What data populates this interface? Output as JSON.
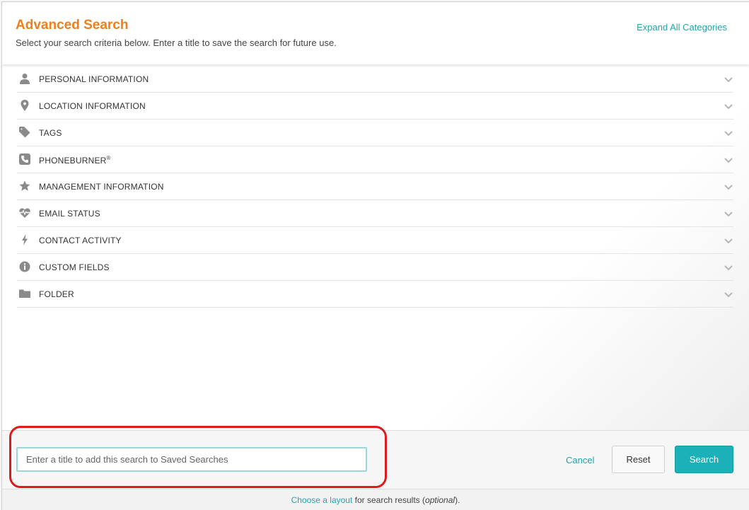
{
  "header": {
    "title": "Advanced Search",
    "subtitle": "Select your search criteria below. Enter a title to save the search for future use.",
    "expand_all": "Expand All Categories"
  },
  "categories": [
    {
      "label": "PERSONAL INFORMATION",
      "icon": "user-icon"
    },
    {
      "label": "LOCATION INFORMATION",
      "icon": "map-pin-icon"
    },
    {
      "label": "TAGS",
      "icon": "tag-icon"
    },
    {
      "label": "PHONEBURNER",
      "sup": "®",
      "icon": "phone-icon"
    },
    {
      "label": "MANAGEMENT INFORMATION",
      "icon": "star-icon"
    },
    {
      "label": "EMAIL STATUS",
      "icon": "heartbeat-icon"
    },
    {
      "label": "CONTACT ACTIVITY",
      "icon": "bolt-icon"
    },
    {
      "label": "CUSTOM FIELDS",
      "icon": "info-circle-icon"
    },
    {
      "label": "FOLDER",
      "icon": "folder-icon"
    }
  ],
  "footer": {
    "title_placeholder": "Enter a title to add this search to Saved Searches",
    "title_value": "",
    "cancel": "Cancel",
    "reset": "Reset",
    "search": "Search"
  },
  "layout_bar": {
    "prefix": "",
    "link": "Choose a layout",
    "middle": " for search results (",
    "optional": "optional",
    "suffix": ")."
  },
  "colors": {
    "accent_orange": "#ef7f1a",
    "link_teal": "#26a3a8",
    "button_teal": "#1cb1b8",
    "highlight_red": "#dc1c1c"
  }
}
